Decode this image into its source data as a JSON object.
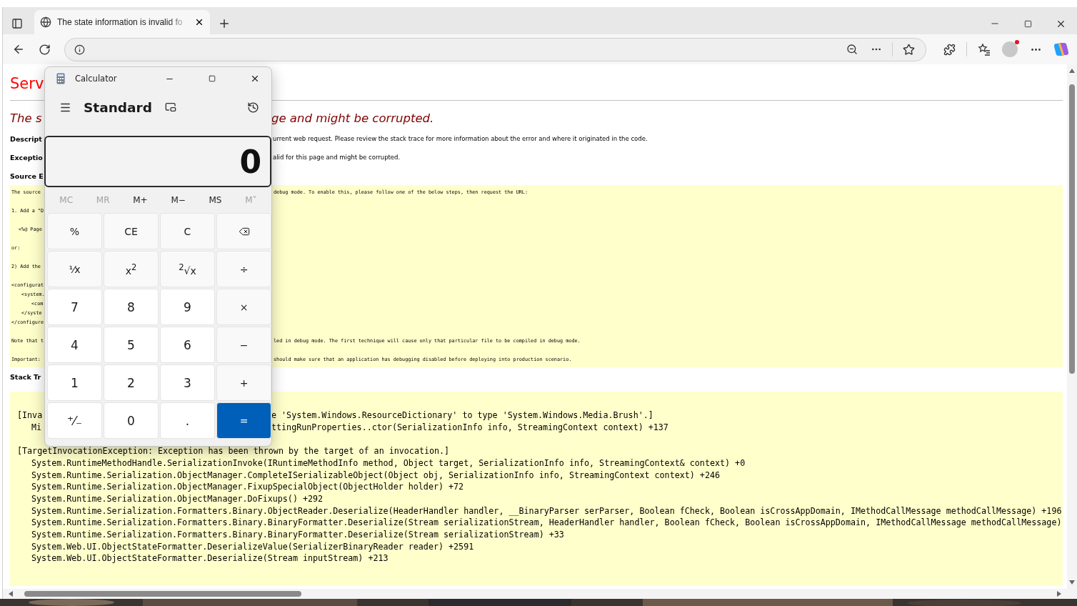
{
  "browser": {
    "tab": {
      "title": "The state information is invalid fo",
      "selected": true
    }
  },
  "page": {
    "heading": "Serv",
    "subheading": {
      "left": "The s",
      "right": "ge and might be corrupted."
    },
    "fields": [
      {
        "label": "Descript",
        "value": "urrent web request. Please review the stack trace for more information about the error and where it originated in the code."
      },
      {
        "label": "Exceptio",
        "value": "alid for this page and might be corrupted."
      },
      {
        "label": "Source E"
      }
    ],
    "source_box": [
      [
        {
          "left": "The source",
          "right": "debug mode. To enable this, please follow one of the below steps, then request the URL:"
        }
      ],
      [
        {
          "left": "1. Add a \"D"
        }
      ],
      [
        {
          "left": "<%@ Page",
          "indent": true
        }
      ],
      [
        {
          "left": "or:"
        }
      ],
      [
        {
          "left": "2) Add the"
        }
      ],
      [
        {
          "left": "<configurat",
          "children": [
            {
              "left": "<system.",
              "children": [
                {
                  "left": "<com"
                }
              ]
            },
            {
              "left": "</syste"
            }
          ]
        },
        {
          "left": "</configure"
        }
      ],
      [
        {
          "left": "Note that t",
          "right": "led in debug mode. The first technique will cause only that particular file to be compiled in debug mode."
        }
      ],
      [
        {
          "left": "Important:",
          "right": "should make sure that an application has debugging disabled before deploying into production scenario."
        }
      ]
    ],
    "stack_label": "Stack Tr",
    "stack_trace": [
      [
        {
          "left": "[Inva",
          "right": "e 'System.Windows.ResourceDictionary' to type 'System.Windows.Media.Brush'.]"
        },
        {
          "left": "Mi",
          "right": "ttingRunProperties..ctor(SerializationInfo info, StreamingContext context) +137",
          "indent": true
        }
      ],
      [
        {
          "left": "[TargetInvocationException: Exception has been thrown by the target of an invocation.]"
        },
        {
          "left": "System.RuntimeMethodHandle.SerializationInvoke(IRuntimeMethodInfo method, Object target, SerializationInfo info, StreamingContext& context) +0",
          "indent": true
        },
        {
          "left": "System.Runtime.Serialization.ObjectManager.CompleteISerializableObject(Object obj, SerializationInfo info, StreamingContext context) +246",
          "indent": true
        },
        {
          "left": "System.Runtime.Serialization.ObjectManager.FixupSpecialObject(ObjectHolder holder) +72",
          "indent": true
        },
        {
          "left": "System.Runtime.Serialization.ObjectManager.DoFixups() +292",
          "indent": true
        },
        {
          "left": "System.Runtime.Serialization.Formatters.Binary.ObjectReader.Deserialize(HeaderHandler handler, __BinaryParser serParser, Boolean fCheck, Boolean isCrossAppDomain, IMethodCallMessage methodCallMessage) +196",
          "indent": true
        },
        {
          "left": "System.Runtime.Serialization.Formatters.Binary.BinaryFormatter.Deserialize(Stream serializationStream, HeaderHandler handler, Boolean fCheck, Boolean isCrossAppDomain, IMethodCallMessage methodCallMessage)",
          "indent": true
        },
        {
          "left": "System.Runtime.Serialization.Formatters.Binary.BinaryFormatter.Deserialize(Stream serializationStream) +33",
          "indent": true
        },
        {
          "left": "System.Web.UI.ObjectStateFormatter.DeserializeValue(SerializerBinaryReader reader) +2591",
          "indent": true
        },
        {
          "left": "System.Web.UI.ObjectStateFormatter.Deserialize(Stream inputStream) +213",
          "indent": true
        }
      ]
    ]
  },
  "calculator": {
    "title": "Calculator",
    "mode": "Standard",
    "display": "0",
    "memory": [
      {
        "label": "MC",
        "disabled": true
      },
      {
        "label": "MR",
        "disabled": true
      },
      {
        "label": "M+",
        "disabled": false
      },
      {
        "label": "M−",
        "disabled": false
      },
      {
        "label": "MS",
        "disabled": false
      },
      {
        "label": "M˅",
        "disabled": true
      }
    ],
    "buttons": [
      {
        "kind": "function",
        "label": "%"
      },
      {
        "kind": "function",
        "label": "CE"
      },
      {
        "kind": "function",
        "label": "C"
      },
      {
        "kind": "backspace"
      },
      {
        "kind": "function",
        "label": "⅟x"
      },
      {
        "kind": "function",
        "label": "x$^{2}$"
      },
      {
        "kind": "function",
        "label": "$^{2}$√x"
      },
      {
        "kind": "function",
        "label": "÷"
      },
      {
        "kind": "digit",
        "label": "7"
      },
      {
        "kind": "digit",
        "label": "8"
      },
      {
        "kind": "digit",
        "label": "9"
      },
      {
        "kind": "function",
        "label": "×"
      },
      {
        "kind": "digit",
        "label": "4"
      },
      {
        "kind": "digit",
        "label": "5"
      },
      {
        "kind": "digit",
        "label": "6"
      },
      {
        "kind": "function",
        "label": "−"
      },
      {
        "kind": "digit",
        "label": "1"
      },
      {
        "kind": "digit",
        "label": "2"
      },
      {
        "kind": "digit",
        "label": "3"
      },
      {
        "kind": "function",
        "label": "+"
      },
      {
        "kind": "digit",
        "label": "⁺⁄₋"
      },
      {
        "kind": "digit",
        "label": "0"
      },
      {
        "kind": "digit",
        "label": "."
      },
      {
        "kind": "equals",
        "label": "="
      }
    ]
  }
}
